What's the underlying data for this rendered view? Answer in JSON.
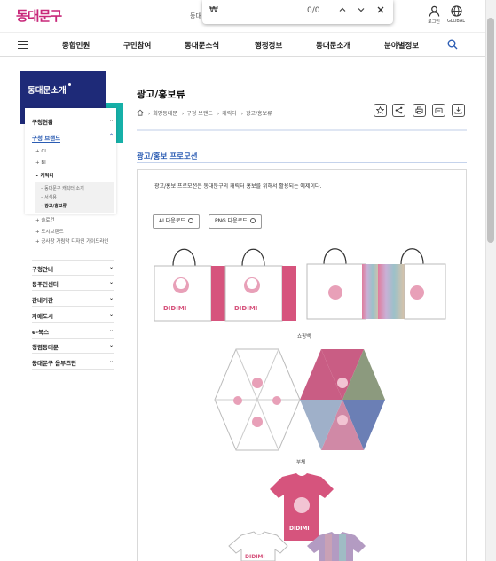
{
  "header": {
    "logo": "동대문구",
    "site_label": "동대",
    "login_label": "로그인",
    "global_label": "GLOBAL"
  },
  "findbar": {
    "query": "₩",
    "count": "0/0"
  },
  "nav": {
    "items": [
      "종합민원",
      "구민참여",
      "동대문소식",
      "행정정보",
      "동대문소개",
      "분야별정보"
    ]
  },
  "lnb": {
    "title": "동대문소개",
    "items": [
      {
        "label": "구청현황"
      },
      {
        "label": "구청 브랜드"
      },
      {
        "label": "구청안내"
      },
      {
        "label": "동주민센터"
      },
      {
        "label": "관내기관"
      },
      {
        "label": "자매도시"
      },
      {
        "label": "e-북스"
      },
      {
        "label": "청렴동대문"
      },
      {
        "label": "동대문구 옴부즈만"
      }
    ],
    "brand_sub": [
      "CI",
      "BI",
      "캐릭터",
      "슬로건",
      "도시브랜드",
      "공사장 가림막 디자인 가이드라인"
    ],
    "character_sub": [
      "동대문구 캐릭터 소개",
      "서식용",
      "광고/홍보류"
    ]
  },
  "page": {
    "title": "광고/홍보류",
    "breadcrumb": [
      "희망동대문",
      "구청 브랜드",
      "캐릭터",
      "광고/홍보류"
    ],
    "section_title": "광고/홍보 프로모션",
    "description": "광고/홍보 프로모션은 동대문구의 캐릭터 홍보를 위해서 활용되는 예제이다.",
    "buttons": [
      "AI 다운로드",
      "PNG 다운로드"
    ],
    "captions": [
      "쇼핑백",
      "부채"
    ],
    "character_name": "DIDIMI"
  },
  "colors": {
    "brand": "#c8287a",
    "navy": "#1e2a78",
    "teal": "#16b0a8",
    "accent_blue": "#2b5cb3",
    "pink": "#d6547d"
  }
}
